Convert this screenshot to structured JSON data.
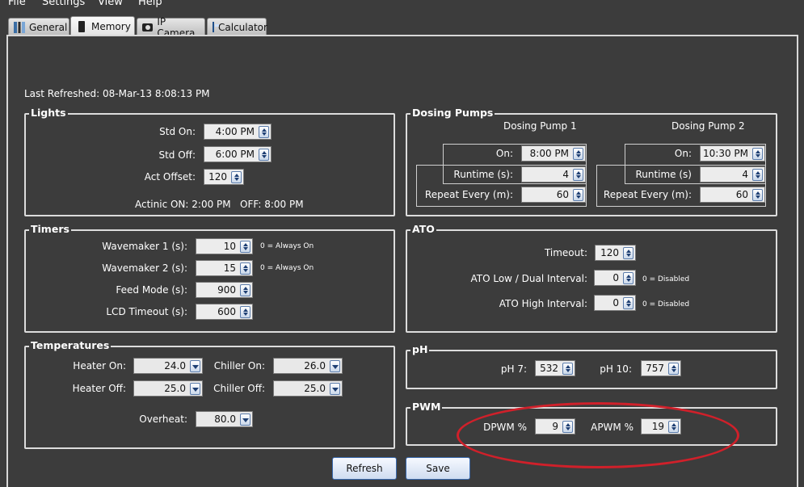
{
  "menu": [
    "File",
    "Settings",
    "View",
    "Help"
  ],
  "tabs": [
    "General",
    "Memory",
    "IP Camera",
    "Calculator"
  ],
  "last_refreshed": "Last Refreshed: 08-Mar-13 8:08:13 PM",
  "lights": {
    "title": "Lights",
    "std_on_label": "Std On:",
    "std_on_value": "4:00 PM",
    "std_off_label": "Std Off:",
    "std_off_value": "6:00 PM",
    "act_offset_label": "Act Offset:",
    "act_offset_value": "120",
    "actinic_text": "Actinic ON: 2:00 PM   OFF: 8:00 PM"
  },
  "dosing": {
    "title": "Dosing Pumps",
    "pump1": {
      "title": "Dosing Pump 1",
      "on_label": "On:",
      "on_value": "8:00 PM",
      "runtime_label": "Runtime (s):",
      "runtime_value": "4",
      "repeat_label": "Repeat Every (m):",
      "repeat_value": "60"
    },
    "pump2": {
      "title": "Dosing Pump 2",
      "on_label": "On:",
      "on_value": "10:30 PM",
      "runtime_label": "Runtime (s)",
      "runtime_value": "4",
      "repeat_label": "Repeat Every (m):",
      "repeat_value": "60"
    }
  },
  "timers": {
    "title": "Timers",
    "wm1_label": "Wavemaker 1 (s):",
    "wm1_value": "10",
    "wm1_note": "0 = Always On",
    "wm2_label": "Wavemaker 2 (s):",
    "wm2_value": "15",
    "wm2_note": "0 = Always On",
    "feed_label": "Feed Mode (s):",
    "feed_value": "900",
    "lcd_label": "LCD Timeout (s):",
    "lcd_value": "600"
  },
  "ato": {
    "title": "ATO",
    "timeout_label": "Timeout:",
    "timeout_value": "120",
    "low_label": "ATO Low / Dual Interval:",
    "low_value": "0",
    "low_note": "0 = Disabled",
    "high_label": "ATO High Interval:",
    "high_value": "0",
    "high_note": "0 = Disabled"
  },
  "temps": {
    "title": "Temperatures",
    "heater_on_label": "Heater On:",
    "heater_on_value": "24.0",
    "heater_off_label": "Heater Off:",
    "heater_off_value": "25.0",
    "chiller_on_label": "Chiller On:",
    "chiller_on_value": "26.0",
    "chiller_off_label": "Chiller Off:",
    "chiller_off_value": "25.0",
    "overheat_label": "Overheat:",
    "overheat_value": "80.0"
  },
  "ph": {
    "title": "pH",
    "ph7_label": "pH 7:",
    "ph7_value": "532",
    "ph10_label": "pH 10:",
    "ph10_value": "757"
  },
  "pwm": {
    "title": "PWM",
    "dpwm_label": "DPWM %",
    "dpwm_value": "9",
    "apwm_label": "APWM %",
    "apwm_value": "19"
  },
  "buttons": {
    "refresh": "Refresh",
    "save": "Save"
  },
  "colors": {
    "background": "#3c3c3c",
    "highlight_ellipse": "#d0202a",
    "button_border": "#3b6bb0"
  }
}
